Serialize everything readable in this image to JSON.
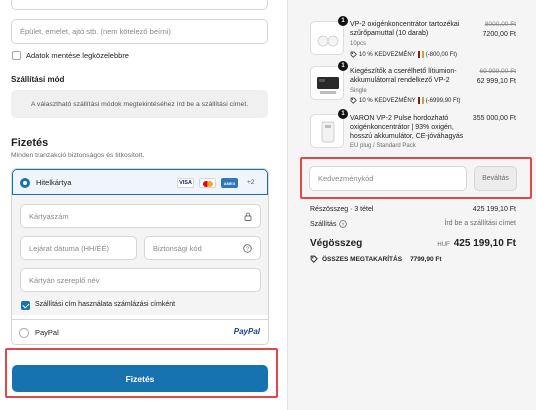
{
  "address": {
    "apartment_placeholder": "Épület, emelet, ajtó stb. (nem kötelező beírni)",
    "save_label": "Adatok mentése legközelebbre"
  },
  "shipping": {
    "title": "Szállítási mód",
    "info": "A választható szállítási módok megtekintéséhez írd be a szállítási címet."
  },
  "payment": {
    "title": "Fizetés",
    "subtitle": "Minden tranzakció biztonságos és titkosított.",
    "card_label": "Hitelkártya",
    "card_brands": [
      "VISA",
      "MC",
      "AMEX"
    ],
    "more_brands": "+2",
    "card_number_placeholder": "Kártyaszám",
    "expiry_placeholder": "Lejárat dátuma (HH/ÉÉ)",
    "cvc_placeholder": "Biztonsági kód",
    "name_placeholder": "Kártyán szereplő név",
    "billing_same_label": "Szállítási cím használata számlázási címként",
    "paypal_label": "PayPal",
    "paypal_logo": "PayPal",
    "pay_button": "Fizetés"
  },
  "cart": {
    "items": [
      {
        "qty": "1",
        "name_line1": "VP-2 oxigénkoncentrátor tartozékai",
        "name_line2": "szűrőpamuttal (10 darab)",
        "variant": "10pcs",
        "discount": "10 % KEDVEZMÉNY",
        "discount_amount": "(-800,00 Ft)",
        "old_price": "8000,00 Ft",
        "price": "7200,00 Ft"
      },
      {
        "qty": "1",
        "name_line1": "Kiegészítők a cserélhető lítiumion-",
        "name_line2": "akkumulátorral rendelkező VP-2",
        "variant": "Single",
        "discount": "10 % KEDVEZMÉNY",
        "discount_amount": "(-6999,90 Ft)",
        "old_price": "69 999,00 Ft",
        "price": "62 999,10 Ft"
      },
      {
        "qty": "1",
        "name_line1": "VARON VP-2 Pulse hordozható",
        "name_line2": "oxigénkoncentrátor | 93% oxigén,",
        "name_line3": "hosszú akkumulátor, CE-jóváhagyás",
        "variant": "EU plug / Standard Pack",
        "price": "355 000,00 Ft"
      }
    ],
    "coupon_placeholder": "Kedvezménykód",
    "apply_button": "Beváltás",
    "subtotal_label": "Részösszeg · 3 tétel",
    "subtotal_value": "425 199,10 Ft",
    "shipping_label": "Szállítás",
    "shipping_value": "Írd be a szállítási címet",
    "total_label": "Végösszeg",
    "currency": "HUF",
    "total_value": "425 199,10 Ft",
    "savings_label": "ÖSSZES MEGTAKARÍTÁS",
    "savings_value": "7799,90 Ft"
  },
  "colors": {
    "accent": "#1773b0",
    "highlight": "#e2474b"
  }
}
